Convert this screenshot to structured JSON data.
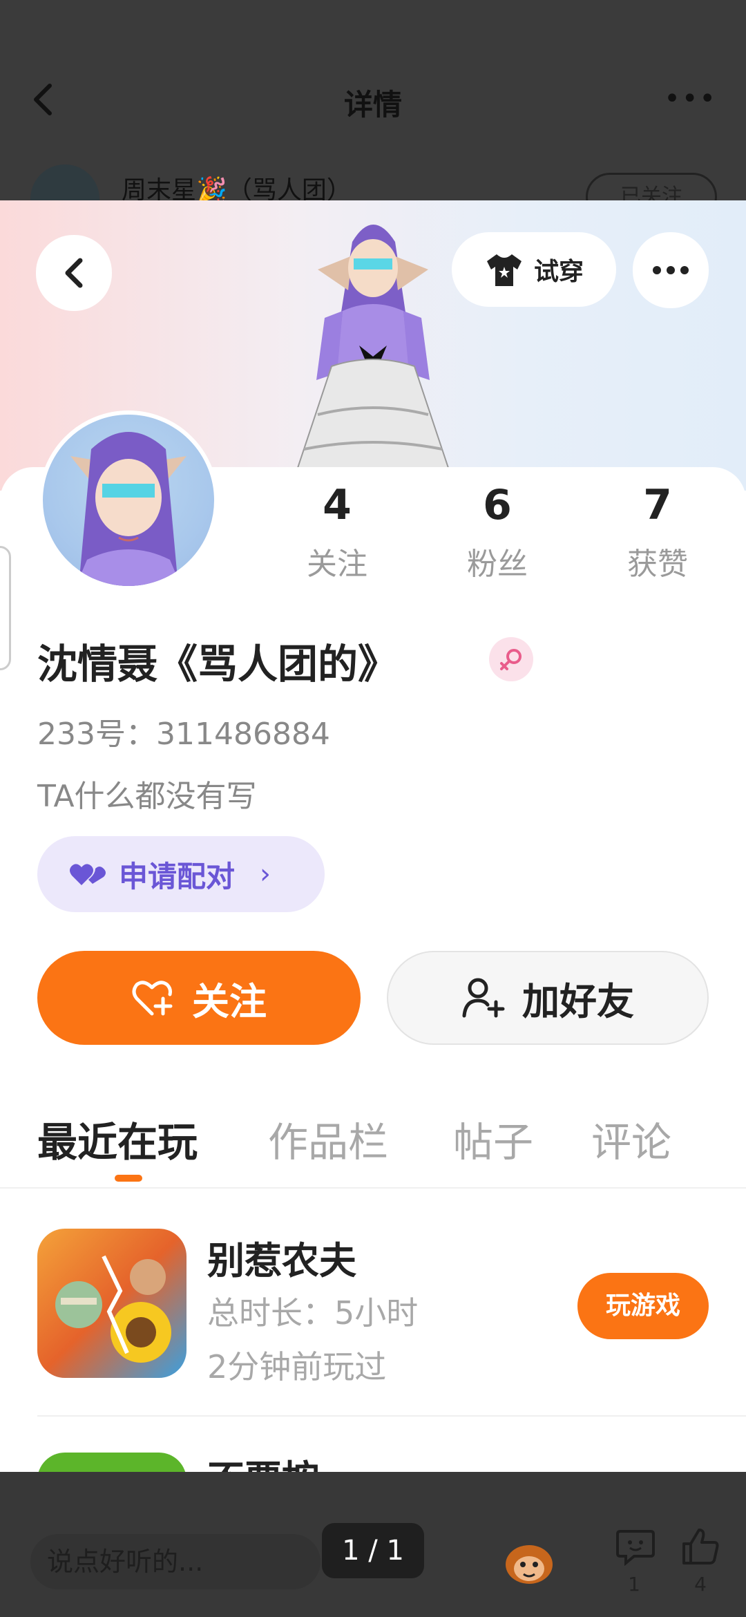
{
  "background": {
    "title": "详情",
    "author_name": "周末星🎉（骂人团）",
    "followed_label": "已关注",
    "comment_placeholder": "说点好听的...",
    "page_indicator": "1 / 1",
    "comment_count": "1",
    "like_count": "4"
  },
  "profile": {
    "tryon_label": "试穿",
    "stats": [
      {
        "value": "4",
        "label": "关注"
      },
      {
        "value": "6",
        "label": "粉丝"
      },
      {
        "value": "7",
        "label": "获赞"
      }
    ],
    "nickname": "沈情聂《骂人团的》",
    "uid": "233号：311486884",
    "bio": "TA什么都没有写",
    "pair_label": "申请配对",
    "follow_label": "关注",
    "add_friend_label": "加好友",
    "colors": {
      "accent": "#fb7414",
      "pair": "#6a56d6",
      "pair_bg": "#ece8fb"
    }
  },
  "tabs": [
    {
      "label": "最近在玩",
      "active": true
    },
    {
      "label": "作品栏",
      "active": false
    },
    {
      "label": "帖子",
      "active": false
    },
    {
      "label": "评论",
      "active": false
    }
  ],
  "games": [
    {
      "name": "别惹农夫",
      "duration": "总时长：5小时",
      "last_played": "2分钟前玩过",
      "action": "玩游戏",
      "icon": "farmer-game-icon"
    },
    {
      "name": "不要按",
      "icon": "second-game-icon"
    }
  ]
}
